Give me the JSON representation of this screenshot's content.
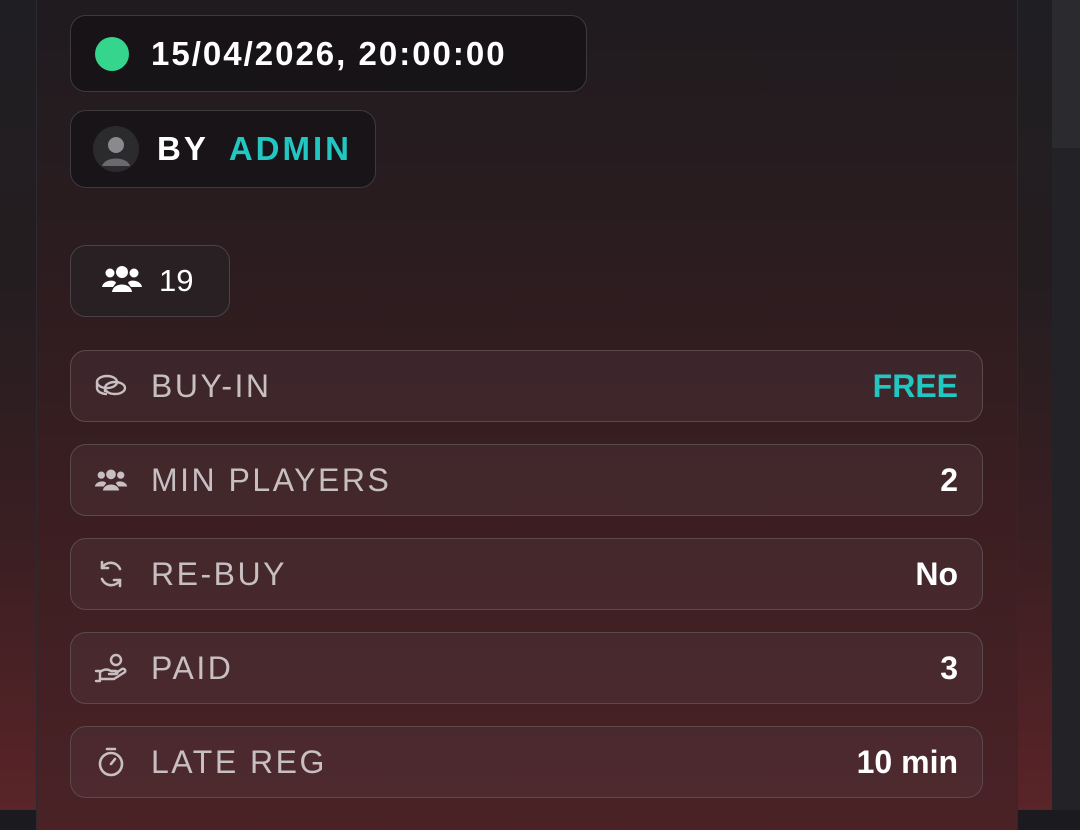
{
  "event": {
    "datetime": "15/04/2026, 20:00:00",
    "status_color": "#35d58e",
    "by_label": "BY",
    "author": "ADMIN",
    "players_count": "19"
  },
  "details": [
    {
      "label": "BUY-IN",
      "value": "FREE",
      "icon": "coins-icon",
      "accent": true
    },
    {
      "label": "MIN PLAYERS",
      "value": "2",
      "icon": "users-icon",
      "accent": false
    },
    {
      "label": "RE-BUY",
      "value": "No",
      "icon": "refresh-icon",
      "accent": false
    },
    {
      "label": "PAID",
      "value": "3",
      "icon": "hand-coin-icon",
      "accent": false
    },
    {
      "label": "LATE REG",
      "value": "10 min",
      "icon": "timer-icon",
      "accent": false
    }
  ],
  "colors": {
    "accent": "#22c7c1",
    "status": "#35d58e"
  }
}
